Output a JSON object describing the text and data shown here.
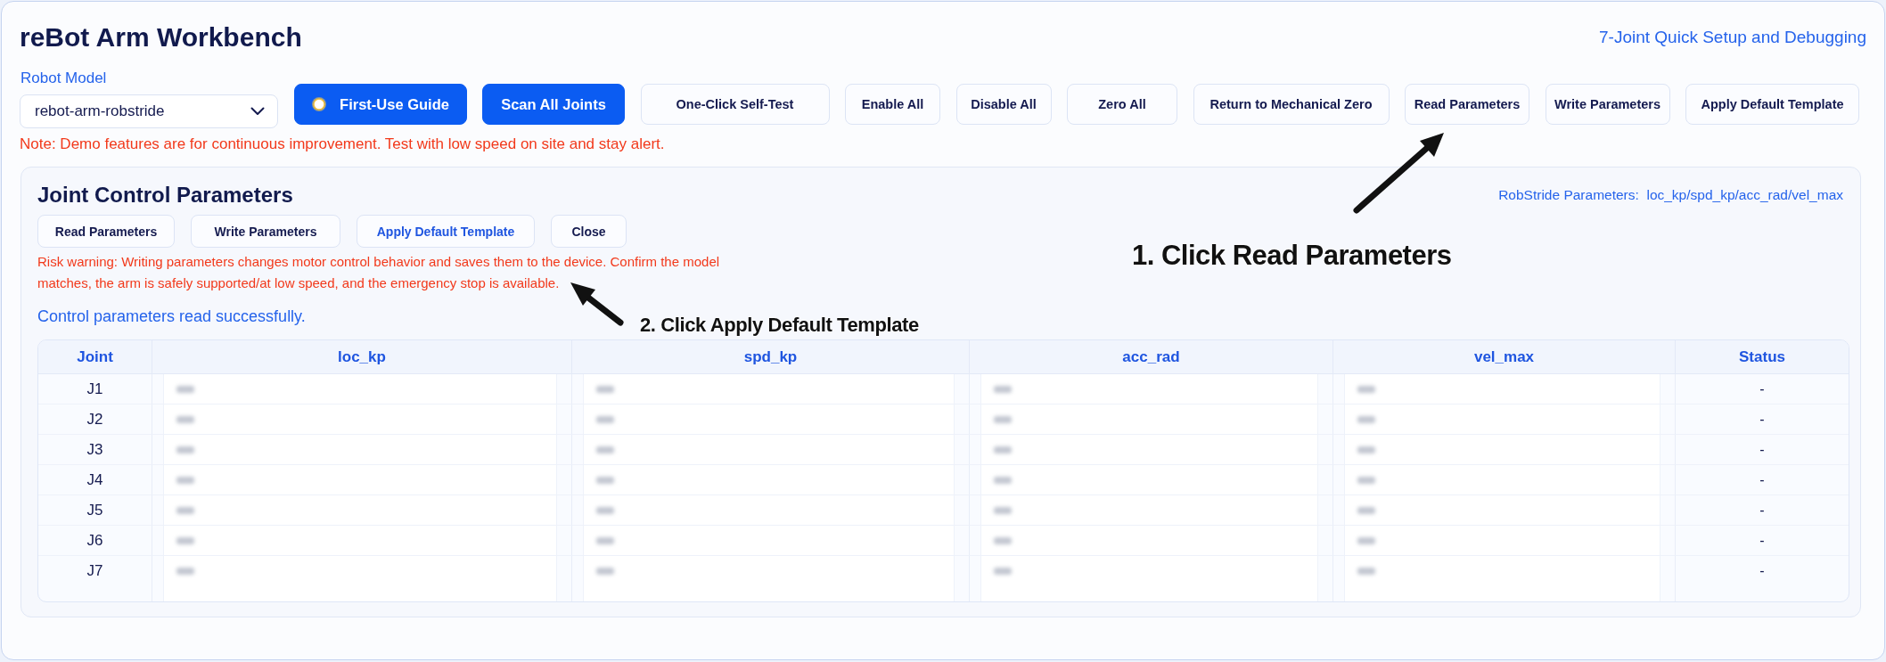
{
  "header": {
    "title": "reBot Arm Workbench",
    "subtitle": "7-Joint Quick Setup and Debugging"
  },
  "model_select": {
    "label": "Robot Model",
    "value": "rebot-arm-robstride"
  },
  "toolbar": [
    {
      "label": "First-Use Guide",
      "kind": "guide"
    },
    {
      "label": "Scan All Joints",
      "kind": "primary"
    },
    {
      "label": "One-Click Self-Test",
      "kind": "secondary"
    },
    {
      "label": "Enable All",
      "kind": "secondary"
    },
    {
      "label": "Disable All",
      "kind": "secondary"
    },
    {
      "label": "Zero All",
      "kind": "secondary"
    },
    {
      "label": "Return to Mechanical Zero",
      "kind": "secondary"
    },
    {
      "label": "Read Parameters",
      "kind": "secondary"
    },
    {
      "label": "Write Parameters",
      "kind": "secondary"
    },
    {
      "label": "Apply Default Template",
      "kind": "secondary"
    }
  ],
  "note": "Note: Demo features are for continuous improvement. Test with low speed on site and stay alert.",
  "panel": {
    "title": "Joint Control Parameters",
    "hint": "RobStride Parameters:  loc_kp/spd_kp/acc_rad/vel_max",
    "buttons": [
      {
        "label": "Read Parameters",
        "kind": "secondary"
      },
      {
        "label": "Write Parameters",
        "kind": "secondary"
      },
      {
        "label": "Apply Default Template",
        "kind": "link"
      },
      {
        "label": "Close",
        "kind": "secondary"
      }
    ],
    "warning": "Risk warning: Writing parameters changes motor control behavior and saves them to the device. Confirm the model matches, the arm is safely supported/at low speed, and the emergency stop is available.",
    "status": "Control parameters read successfully.",
    "table": {
      "columns": [
        "Joint",
        "loc_kp",
        "spd_kp",
        "acc_rad",
        "vel_max",
        "Status"
      ],
      "rows": [
        {
          "joint": "J1",
          "values": [
            {
              "redacted": true
            },
            {
              "redacted": true
            },
            {
              "redacted": true
            },
            {
              "redacted": true
            }
          ],
          "status": "-"
        },
        {
          "joint": "J2",
          "values": [
            {
              "redacted": true
            },
            {
              "redacted": true
            },
            {
              "redacted": true
            },
            {
              "redacted": true
            }
          ],
          "status": "-"
        },
        {
          "joint": "J3",
          "values": [
            {
              "redacted": true
            },
            {
              "redacted": true
            },
            {
              "redacted": true
            },
            {
              "redacted": true
            }
          ],
          "status": "-"
        },
        {
          "joint": "J4",
          "values": [
            {
              "redacted": true
            },
            {
              "redacted": true
            },
            {
              "redacted": true
            },
            {
              "redacted": true
            }
          ],
          "status": "-"
        },
        {
          "joint": "J5",
          "values": [
            {
              "redacted": true
            },
            {
              "redacted": true
            },
            {
              "redacted": true
            },
            {
              "redacted": true
            }
          ],
          "status": "-"
        },
        {
          "joint": "J6",
          "values": [
            {
              "redacted": true
            },
            {
              "redacted": true
            },
            {
              "redacted": true
            },
            {
              "redacted": true
            }
          ],
          "status": "-"
        },
        {
          "joint": "J7",
          "values": [
            {
              "redacted": true
            },
            {
              "redacted": true
            },
            {
              "redacted": true
            },
            {
              "redacted": true
            }
          ],
          "status": "-"
        }
      ]
    }
  },
  "annotations": [
    {
      "text": "1. Click Read Parameters"
    },
    {
      "text": "2. Click Apply Default Template"
    }
  ]
}
